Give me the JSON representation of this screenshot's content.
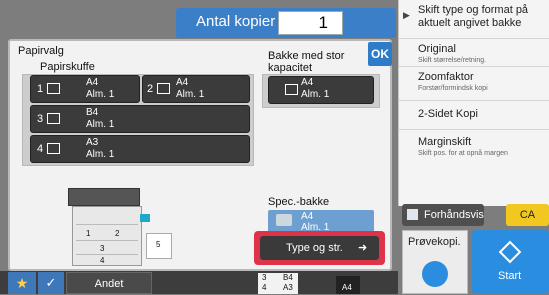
{
  "copies": {
    "label": "Antal kopier",
    "value": "1"
  },
  "menu": {
    "items": [
      {
        "title_1": "Skift type og format på",
        "title_2": "aktuelt angivet bakke",
        "sub": ""
      },
      {
        "title": "Original",
        "sub": "Skift størrelse/retning."
      },
      {
        "title": "Zoomfaktor",
        "sub": "Forstør/formindsk kopi"
      },
      {
        "title": "2-Sidet Kopi",
        "sub": ""
      },
      {
        "title": "Marginskift",
        "sub": "Skift pos. for at opnå margen"
      }
    ]
  },
  "dialog": {
    "title": "Papirvalg",
    "ok": "OK",
    "tray_section": "Papirskuffe",
    "big_tray_label_1": "Bakke med stor",
    "big_tray_label_2": "kapacitet",
    "spec_label": "Spec.-bakke",
    "trays": [
      {
        "num": "1",
        "size": "A4",
        "type": "Alm. 1"
      },
      {
        "num": "2",
        "size": "A4",
        "type": "Alm. 1"
      },
      {
        "num": "3",
        "size": "B4",
        "type": "Alm. 1"
      },
      {
        "num": "4",
        "size": "A3",
        "type": "Alm. 1"
      }
    ],
    "big_tray": {
      "size": "A4",
      "type": "Alm. 1"
    },
    "spec_tray": {
      "size": "A4",
      "type": "Alm. 1"
    },
    "type_button": "Type og str.",
    "printer_labels": [
      "1",
      "2",
      "3",
      "4",
      "5"
    ]
  },
  "bottom": {
    "other": "Andet",
    "status": [
      {
        "num": "3",
        "size": "B4"
      },
      {
        "num": "4",
        "size": "A3"
      }
    ],
    "paper": "A4"
  },
  "right_bottom": {
    "preview": "Forhåndsvis",
    "ca": "CA",
    "preview_copy": "Prøvekopi.",
    "start": "Start"
  },
  "colors": {
    "accent": "#3a7fc8",
    "highlight": "#e0334a",
    "ca": "#f0c81f",
    "start": "#2b8de0"
  }
}
